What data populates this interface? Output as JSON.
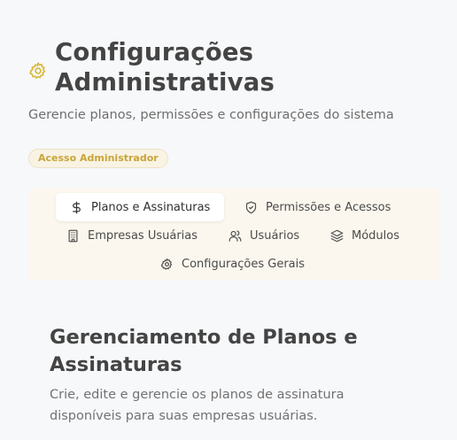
{
  "header": {
    "title": "Configurações Administrativas",
    "subtitle": "Gerencie planos, permissões e configurações do sistema",
    "badge": "Acesso Administrador",
    "icon": "gear-icon"
  },
  "tabs": [
    {
      "label": "Planos e Assinaturas",
      "icon": "dollar-icon",
      "active": true
    },
    {
      "label": "Permissões e Acessos",
      "icon": "shield-icon",
      "active": false
    },
    {
      "label": "Empresas Usuárias",
      "icon": "building-icon",
      "active": false
    },
    {
      "label": "Usuários",
      "icon": "users-icon",
      "active": false
    },
    {
      "label": "Módulos",
      "icon": "layers-icon",
      "active": false
    },
    {
      "label": "Configurações Gerais",
      "icon": "gear-icon",
      "active": false
    }
  ],
  "section": {
    "title": "Gerenciamento de Planos e Assinaturas",
    "description": "Crie, edite e gerencie os planos de assinatura disponíveis para suas empresas usuárias."
  },
  "colors": {
    "accent": "#d8b73c",
    "badge_bg": "#f8f3e3",
    "badge_text": "#c9a43a",
    "tabs_bg": "#fcf7ee",
    "page_bg": "#f7f8fa"
  }
}
